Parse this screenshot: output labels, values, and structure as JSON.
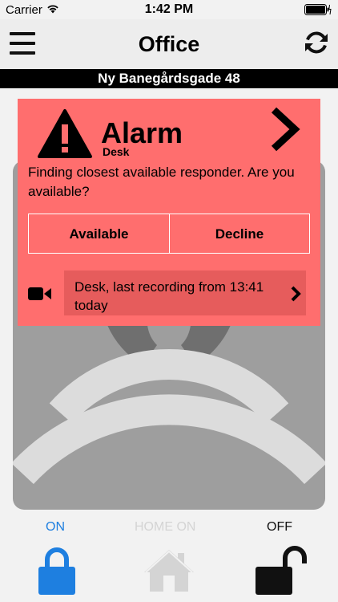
{
  "status_bar": {
    "carrier": "Carrier",
    "time": "1:42 PM",
    "icons": [
      "wifi-icon",
      "battery-icon"
    ]
  },
  "nav": {
    "title": "Office",
    "left_icon": "hamburger-menu-icon",
    "right_icon": "refresh-icon"
  },
  "address": "Ny Banegårdsgade 48",
  "alarm": {
    "title": "Alarm",
    "subtitle": "Desk",
    "message": "Finding closest available responder. Are you available?",
    "buttons": {
      "available": "Available",
      "decline": "Decline"
    },
    "recording": {
      "text": "Desk, last recording from 13:41 today",
      "icon": "video-camera-icon"
    },
    "colors": {
      "background": "#ff6e6e",
      "recording_box": "#e65c5c"
    }
  },
  "modes": {
    "on_label": "ON",
    "home_label": "HOME ON",
    "off_label": "OFF",
    "colors": {
      "on": "#1e7fe0",
      "home": "#d4d4d4",
      "off": "#111111"
    }
  }
}
